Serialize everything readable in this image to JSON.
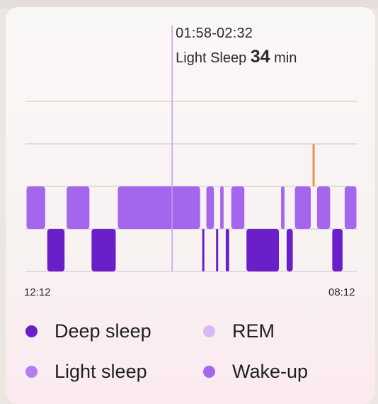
{
  "tooltip": {
    "time_range": "01:58-02:32",
    "stage": "Light Sleep",
    "value": "34",
    "unit": "min"
  },
  "axis": {
    "start": "12:12",
    "end": "08:12"
  },
  "legend": [
    {
      "label": "Deep sleep",
      "color": "#6a1fc9"
    },
    {
      "label": "REM",
      "color": "#d9b8f4"
    },
    {
      "label": "Light sleep",
      "color": "#b07ef0"
    },
    {
      "label": "Wake-up",
      "color": "#a466ee"
    }
  ],
  "colors": {
    "deep": "#6a1fc9",
    "light": "#a366ec",
    "wake_marker": "#f0914a",
    "cursor": "#c79df2",
    "grid": "#c9c5c5"
  },
  "chart_data": {
    "type": "bar",
    "x_unit": "minutes after 00:12",
    "start_time": "12:12",
    "end_time": "08:12",
    "rows_top_to_bottom": [
      "Wake-up",
      "REM",
      "Light sleep",
      "Deep sleep"
    ],
    "cursor_minutes": 106,
    "segments": [
      {
        "stage": "Light sleep",
        "start": 0,
        "end": 15
      },
      {
        "stage": "Deep sleep",
        "start": 15,
        "end": 29
      },
      {
        "stage": "Light sleep",
        "start": 29,
        "end": 47
      },
      {
        "stage": "Deep sleep",
        "start": 47,
        "end": 66
      },
      {
        "stage": "Light sleep",
        "start": 66,
        "end": 127
      },
      {
        "stage": "Deep sleep",
        "start": 127,
        "end": 130
      },
      {
        "stage": "Light sleep",
        "start": 130,
        "end": 137
      },
      {
        "stage": "Deep sleep",
        "start": 137,
        "end": 140
      },
      {
        "stage": "Light sleep",
        "start": 140,
        "end": 144
      },
      {
        "stage": "Deep sleep",
        "start": 144,
        "end": 148
      },
      {
        "stage": "Light sleep",
        "start": 148,
        "end": 159
      },
      {
        "stage": "Deep sleep",
        "start": 159,
        "end": 184
      },
      {
        "stage": "Light sleep",
        "start": 184,
        "end": 188
      },
      {
        "stage": "Deep sleep",
        "start": 188,
        "end": 194
      },
      {
        "stage": "Light sleep",
        "start": 194,
        "end": 207
      },
      {
        "stage": "Wake-up",
        "start": 207,
        "end": 210
      },
      {
        "stage": "Light sleep",
        "start": 210,
        "end": 221
      },
      {
        "stage": "Deep sleep",
        "start": 221,
        "end": 230
      },
      {
        "stage": "Light sleep",
        "start": 230,
        "end": 240
      }
    ]
  }
}
